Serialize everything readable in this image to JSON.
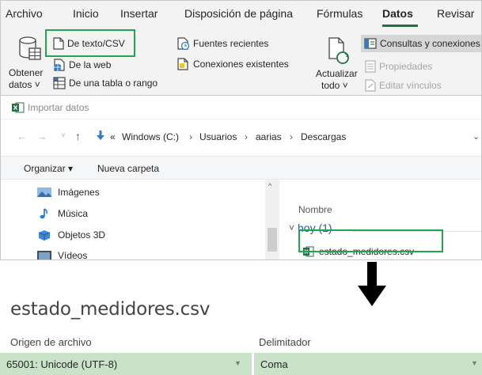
{
  "ribbon": {
    "tabs": [
      "Archivo",
      "Inicio",
      "Insertar",
      "Disposición de página",
      "Fórmulas",
      "Datos",
      "Revisar"
    ],
    "active_tab": "Datos",
    "get_data": {
      "line1": "Obtener",
      "line2": "datos ˅"
    },
    "from_text_csv": "De texto/CSV",
    "from_web": "De la web",
    "from_table": "De una tabla o rango",
    "recent_sources": "Fuentes recientes",
    "existing_connections": "Conexiones existentes",
    "refresh_all": {
      "line1": "Actualizar",
      "line2": "todo ˅"
    },
    "queries_connections": "Consultas y conexiones",
    "properties": "Propiedades",
    "edit_links": "Editar vínculos"
  },
  "dialog": {
    "title": "Importar datos",
    "breadcrumb": [
      "«",
      "Windows (C:)",
      "Usuarios",
      "aarias",
      "Descargas"
    ],
    "organize_label": "Organizar ▾",
    "new_folder_label": "Nueva carpeta",
    "nav_items": [
      {
        "label": "Imágenes",
        "icon": "pictures-folder-icon"
      },
      {
        "label": "Música",
        "icon": "music-folder-icon"
      },
      {
        "label": "Objetos 3D",
        "icon": "3d-objects-folder-icon"
      },
      {
        "label": "Vídeos",
        "icon": "videos-folder-icon"
      }
    ],
    "column_name": "Nombre",
    "group_label": "hoy (1)",
    "file_name": "estado_medidores.csv"
  },
  "preview": {
    "file_title": "estado_medidores.csv",
    "origin_label": "Origen de archivo",
    "origin_value": "65001: Unicode (UTF-8)",
    "delimiter_label": "Delimitador",
    "delimiter_value": "Coma"
  },
  "colors": {
    "highlight": "#23a54f",
    "excel_green": "#217346",
    "select_bg": "#c9e3c9",
    "group_blue": "#1e5aa0"
  }
}
